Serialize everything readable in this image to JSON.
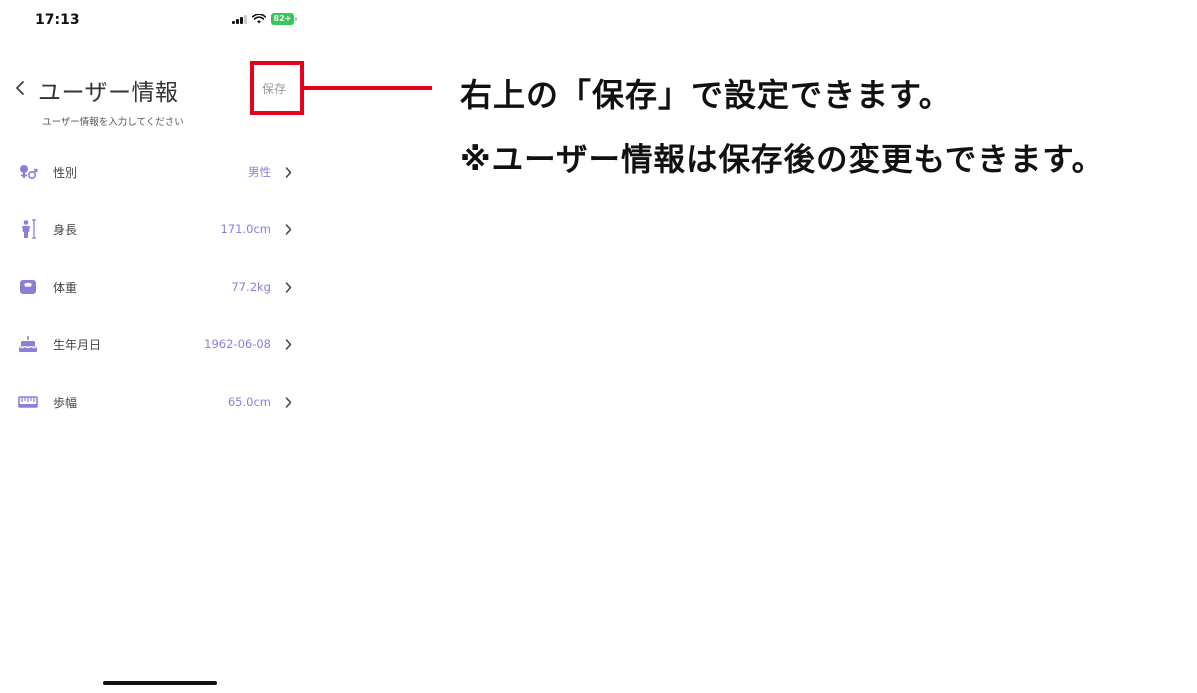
{
  "status_bar": {
    "time": "17:13",
    "battery": "82+"
  },
  "header": {
    "title": "ユーザー情報",
    "subtitle": "ユーザー情報を入力してください",
    "save_label": "保存"
  },
  "settings": [
    {
      "label": "性別",
      "value": "男性",
      "icon": "gender-icon"
    },
    {
      "label": "身長",
      "value": "171.0cm",
      "icon": "height-icon"
    },
    {
      "label": "体重",
      "value": "77.2kg",
      "icon": "scale-icon"
    },
    {
      "label": "生年月日",
      "value": "1962-06-08",
      "icon": "birthday-cake-icon"
    },
    {
      "label": "歩幅",
      "value": "65.0cm",
      "icon": "ruler-icon"
    }
  ],
  "annotation": {
    "line1": "右上の「保存」で設定できます。",
    "line2": "※ユーザー情報は保存後の変更もできます。"
  },
  "colors": {
    "accent": "#8b7fd9",
    "highlight": "#e8001c",
    "battery": "#34c759"
  }
}
